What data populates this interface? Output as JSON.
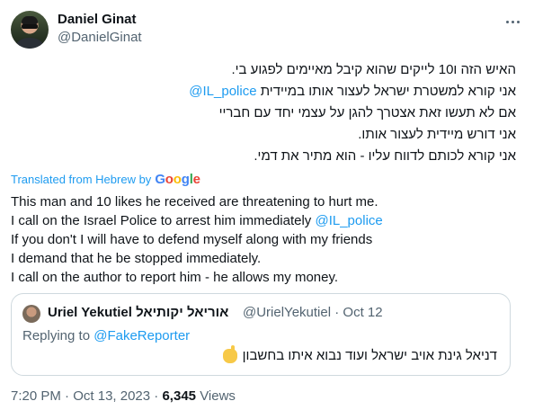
{
  "author": {
    "name": "Daniel Ginat",
    "handle": "@DanielGinat"
  },
  "more_icon": "more-horizontal-icon",
  "hebrew_lines": [
    "האיש הזה ו10 לייקים שהוא קיבל מאיימים לפגוע בי.",
    "אני קורא למשטרת ישראל לעצור אותו במיידית ",
    "אם לא תעשו זאת אצטרך להגן על עצמי יחד עם חבריי",
    "אני דורש מיידית לעצור אותו.",
    "אני קורא לכותם לדווח עליו - הוא מתיר את דמי."
  ],
  "hebrew_mention": "@IL_police",
  "translation": {
    "label": "Translated from Hebrew by",
    "google": [
      "G",
      "o",
      "o",
      "g",
      "l",
      "e"
    ]
  },
  "english_lines": [
    "This man and 10 likes he received are threatening to hurt me.",
    "I call on the Israel Police to arrest him immediately ",
    "If you don't I will have to defend myself along with my friends",
    "I demand that he be stopped immediately.",
    "I call on the author to report him - he allows my money."
  ],
  "english_mention": "@IL_police",
  "quoted": {
    "name": "Uriel Yekutiel אוריאל יקותיאל",
    "handle": "@UrielYekutiel",
    "date": "Oct 12",
    "replying_prefix": "Replying to ",
    "replying_to": "@FakeReporter",
    "text": "דניאל גינת אויב ישראל ועוד נבוא איתו בחשבון",
    "emoji": "ok-hand-icon"
  },
  "footer": {
    "time": "7:20 PM",
    "date": "Oct 13, 2023",
    "views_count": "6,345",
    "views_label": "Views"
  },
  "colors": {
    "link": "#1d9bf0",
    "secondary": "#536471",
    "text": "#0f1419",
    "border": "#cfd9de"
  }
}
